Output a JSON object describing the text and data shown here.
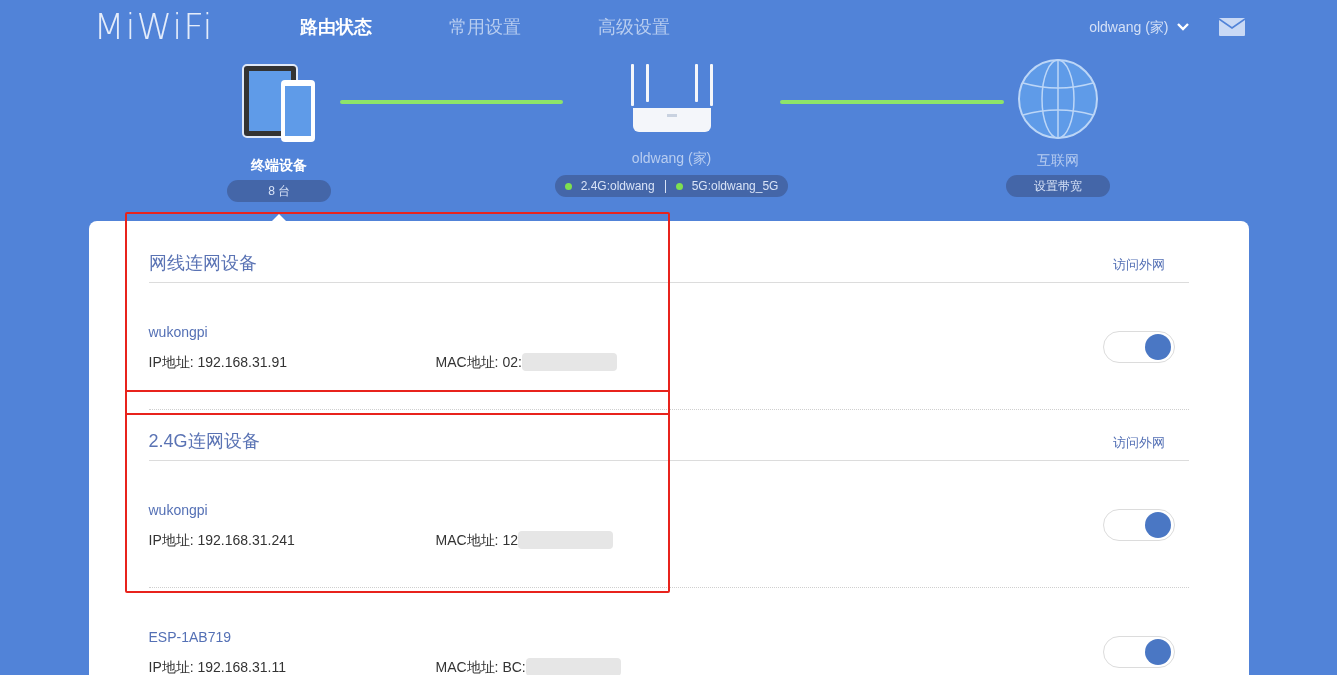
{
  "header": {
    "logo": "MiWiFi",
    "tabs": [
      {
        "label": "路由状态",
        "selected": true
      },
      {
        "label": "常用设置",
        "selected": false
      },
      {
        "label": "高级设置",
        "selected": false
      }
    ],
    "user": "oldwang (家)"
  },
  "topology": {
    "devices": {
      "label": "终端设备",
      "count": "8 台",
      "selected": true
    },
    "router": {
      "name": "oldwang (家)",
      "bands": [
        {
          "label": "2.4G:oldwang",
          "color": "#7ee04f"
        },
        {
          "label": "5G:oldwang_5G",
          "color": "#7ee04f"
        }
      ]
    },
    "internet": {
      "label": "互联网",
      "action": "设置带宽"
    }
  },
  "sections": [
    {
      "title": "网线连网设备",
      "column_label": "访问外网",
      "highlighted": true,
      "devices": [
        {
          "name": "wukongpi",
          "ip": "IP地址: 192.168.31.91",
          "mac": "MAC地址: 02:",
          "mac_redacted": true,
          "internet_access": true
        }
      ]
    },
    {
      "title": "2.4G连网设备",
      "column_label": "访问外网",
      "highlighted": true,
      "devices": [
        {
          "name": "wukongpi",
          "ip": "IP地址: 192.168.31.241",
          "mac": "MAC地址: 12",
          "mac_redacted": true,
          "internet_access": true
        },
        {
          "name": "ESP-1AB719",
          "ip": "IP地址: 192.168.31.11",
          "mac": "MAC地址: BC:",
          "mac_redacted": true,
          "internet_access": true
        }
      ]
    }
  ]
}
